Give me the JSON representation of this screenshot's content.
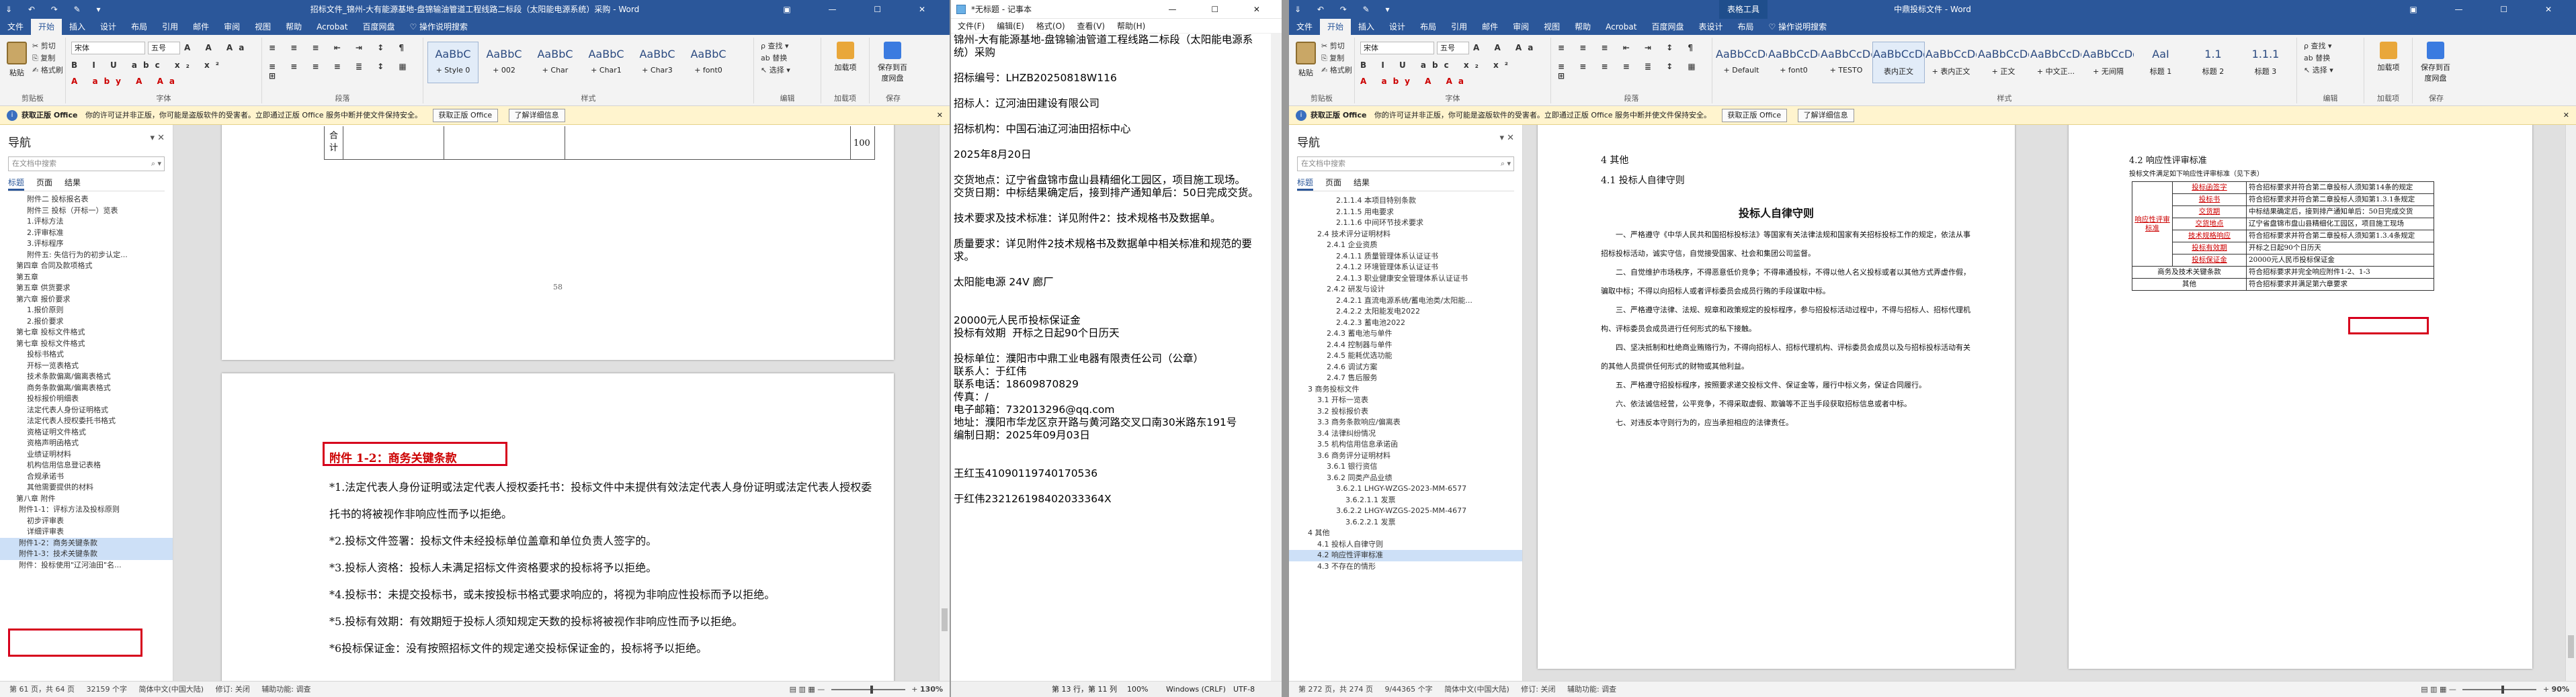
{
  "left_word": {
    "title": "招标文件_锦州-大有能源基地-盘锦输油管道工程线路二标段（太阳能电源系统）采购 - Word",
    "quick_access": "⇓ ↶ ↷ ✎ ▾",
    "window_controls": "▣ — ☐ ✕",
    "tabs": [
      "文件",
      "开始",
      "插入",
      "设计",
      "布局",
      "引用",
      "邮件",
      "审阅",
      "视图",
      "帮助",
      "Acrobat",
      "百度网盘",
      "♡ 操作说明搜索"
    ],
    "ribbon": {
      "paste": "粘贴",
      "cut": "✂ 剪切",
      "copy": "⎘ 复制",
      "format_painter": "✍ 格式刷",
      "font_name": "宋体",
      "font_size": "五号",
      "bold_row": "B I U abc x₂ x²",
      "color_row": "A aby A Aa",
      "para_row1": "≡ ≡ ≡ ⇤ ⇥ ↕ ¶",
      "para_row2": "≡ ≡ ≡ ≡ ≣ ↕ ▦ ⊞",
      "groups": [
        "剪贴板",
        "字体",
        "段落",
        "样式",
        "编辑",
        "加载项",
        "保存"
      ],
      "styles": [
        {
          "sample": "AaBbC",
          "name": "+ Style 0"
        },
        {
          "sample": "AaBbC",
          "name": "+ 002"
        },
        {
          "sample": "AaBbC",
          "name": "+ Char"
        },
        {
          "sample": "AaBbC",
          "name": "+ Char1"
        },
        {
          "sample": "AaBbC",
          "name": "+ Char3"
        },
        {
          "sample": "AaBbC",
          "name": "+ font0"
        }
      ],
      "find": "ρ 查找 ▾",
      "replace": "ab 替换",
      "select": "↖ 选择 ▾",
      "addins": "加载项",
      "save_baidu": "保存到百度网盘"
    },
    "warning": {
      "label": "获取正版 Office",
      "text": "你的许可证并非正版，你可能是盗版软件的受害者。立即通过正版 Office 服务中断并使文件保持安全。",
      "btn1": "获取正版 Office",
      "btn2": "了解详细信息"
    },
    "nav": {
      "title": "导航",
      "search_placeholder": "在文档中搜索",
      "tabs": [
        "标题",
        "页面",
        "结果"
      ],
      "items": [
        "附件二 投标报名表",
        "附件三 投标（开标一）览表",
        "1.评标方法",
        "2.评审标准",
        "3.评标程序",
        "附件五: 失信行为的初步认定...",
        "第四章 合同及款项格式",
        "第五章",
        "第五章 供货要求",
        "第六章 报价要求",
        "1.报价原则",
        "2.报价要求",
        "第七章 投标文件格式",
        "第七章 投标文件格式",
        "投标书格式",
        "开标一览表格式",
        "技术条款偏离/偏离表格式",
        "商务条款偏离/偏离表格式",
        "投标报价明细表",
        "法定代表人身份证明格式",
        "法定代表人授权委托书格式",
        "资格证明文件格式",
        "资格声明函格式",
        "业绩证明材料",
        "机构信用信息登记表格",
        "合规承诺书",
        "其他需要提供的材料",
        "第八章 附件",
        "附件1-1：评标方法及投标原则",
        "初步评审表",
        "详细评审表",
        "附件1-2：商务关键条款",
        "附件1-3：技术关键条款",
        "附件：投标使用\"辽河油田\"名..."
      ],
      "selected": [
        31,
        32
      ]
    },
    "page1": {
      "cell1": "合\n计",
      "cell_end": "100",
      "pageno": "58"
    },
    "page2": {
      "heading": "附件 1-2：商务关键条款",
      "paras": [
        "*1.法定代表人身份证明或法定代表人授权委托书：投标文件中未提供有效法定代表人身份证明或法定代表人授权委托书的将被视作非响应性而予以拒绝。",
        "*2.投标文件签署：投标文件未经投标单位盖章和单位负责人签字的。",
        "*3.投标人资格：投标人未满足招标文件资格要求的投标将予以拒绝。",
        "*4.投标书：未提交投标书，或未按投标书格式要求响应的，将视为非响应性投标而予以拒绝。",
        "*5.投标有效期：有效期短于投标人须知规定天数的投标将被视作非响应性而予以拒绝。",
        "*6投标保证金：没有按照招标文件的规定递交投标保证金的，投标将予以拒绝。"
      ]
    },
    "status": {
      "page": "第 61 页，共 64 页",
      "words": "32159 个字",
      "lang": "简体中文(中国大陆)",
      "track": "修订: 关闭",
      "access": "辅助功能: 调查",
      "zoom": "130%"
    }
  },
  "notepad": {
    "title": "*无标题 - 记事本",
    "window_controls": "— ☐ ✕",
    "menu": [
      "文件(F)",
      "编辑(E)",
      "格式(O)",
      "查看(V)",
      "帮助(H)"
    ],
    "text": "锦州-大有能源基地-盘锦输油管道工程线路二标段（太阳能电源系统）采购\n\n招标编号：LHZB20250818W116\n\n招标人：辽河油田建设有限公司\n\n招标机构：中国石油辽河油田招标中心\n\n2025年8月20日\n\n交货地点：辽宁省盘锦市盘山县精细化工园区，项目施工现场。\n交货日期：中标结果确定后，接到排产通知单后：50日完成交货。\n\n技术要求及技术标准：详见附件2：技术规格书及数据单。\n\n质量要求：详见附件2技术规格书及数据单中相关标准和规范的要求。\n\n太阳能电源 24V 廊厂\n\n\n20000元人民币投标保证金\n投标有效期  开标之日起90个日历天\n\n投标单位：濮阳市中鼎工业电器有限责任公司（公章）\n联系人：于红伟\n联系电话：18609870829\n传真：/\n电子邮箱：732013296@qq.com\n地址：濮阳市华龙区京开路与黄河路交叉口南30米路东191号\n编制日期：2025年09月03日\n\n\n王红玉41090119740170536\n\n于红伟232126198402033364X",
    "status": {
      "pos": "第 13 行，第 11 列",
      "zoom": "100%",
      "eol": "Windows (CRLF)",
      "enc": "UTF-8"
    }
  },
  "right_word": {
    "title": "中鼎投标文件 - Word",
    "context_tab": "表格工具",
    "quick_access": "⇓ ↶ ↷ ✎ ▾",
    "window_controls": "▣ — ☐ ✕",
    "tabs": [
      "文件",
      "开始",
      "插入",
      "设计",
      "布局",
      "引用",
      "邮件",
      "审阅",
      "视图",
      "帮助",
      "Acrobat",
      "百度网盘",
      "表设计",
      "布局",
      "♡ 操作说明搜索"
    ],
    "ribbon": {
      "paste": "粘贴",
      "cut": "✂ 剪切",
      "copy": "⎘ 复制",
      "format_painter": "✍ 格式刷",
      "font_name": "宋体",
      "font_size": "五号",
      "bold_row": "B I U abc x₂ x²",
      "color_row": "A aby A Aa",
      "para_row1": "≡ ≡ ≡ ⇤ ⇥ ↕ ¶",
      "para_row2": "≡ ≡ ≡ ≡ ≣ ↕ ▦ ⊞",
      "groups": [
        "剪贴板",
        "字体",
        "段落",
        "样式",
        "编辑",
        "加载项",
        "保存"
      ],
      "styles": [
        {
          "sample": "AaBbCcDc",
          "name": "+ Default"
        },
        {
          "sample": "AaBbCcDc",
          "name": "+ font0"
        },
        {
          "sample": "AaBbCcDc",
          "name": "+ TESTO"
        },
        {
          "sample": "AaBbCcDd",
          "name": "表内正文"
        },
        {
          "sample": "AaBbCcDd",
          "name": "+ 表内正文"
        },
        {
          "sample": "AaBbCcDd",
          "name": "+ 正文"
        },
        {
          "sample": "AaBbCcDd",
          "name": "+ 中文正..."
        },
        {
          "sample": "AaBbCcDd",
          "name": "+ 无间隔"
        },
        {
          "sample": "AaI",
          "name": "标题 1"
        },
        {
          "sample": "1.1",
          "name": "标题 2"
        },
        {
          "sample": "1.1.1",
          "name": "标题 3"
        }
      ],
      "find": "ρ 查找 ▾",
      "replace": "ab 替换",
      "select": "↖ 选择 ▾",
      "addins": "加载项",
      "save_baidu": "保存到百度网盘"
    },
    "warning": {
      "label": "获取正版 Office",
      "text": "你的许可证并非正版，你可能是盗版软件的受害者。立即通过正版 Office 服务中断并使文件保持安全。",
      "btn1": "获取正版 Office",
      "btn2": "了解详细信息"
    },
    "nav": {
      "title": "导航",
      "search_placeholder": "在文档中搜索",
      "tabs": [
        "标题",
        "页面",
        "结果"
      ],
      "items": [
        "2.1.1.4 本项目特别条款",
        "2.1.1.5 用电要求",
        "2.1.1.6 中间环节技术要求",
        "2.4 技术评分证明材料",
        "2.4.1 企业资质",
        "2.4.1.1 质量管理体系认证证书",
        "2.4.1.2 环境管理体系认证证书",
        "2.4.1.3 职业健康安全管理体系认证证书",
        "2.4.2 研发与设计",
        "2.4.2.1 直流电源系统/蓄电池类/太阳能...",
        "2.4.2.2 太阳能发电2022",
        "2.4.2.3 蓄电池2022",
        "2.4.3 蓄电池与单件",
        "2.4.4 控制器与单件",
        "2.4.5 能耗优选功能",
        "2.4.6 调试方案",
        "2.4.7 售后服务",
        "3 商务投标文件",
        "3.1 开标一览表",
        "3.2 投标报价表",
        "3.3 商务条款响应/偏离表",
        "3.4 法律纠纷情况",
        "3.5 机构信用信息承诺函",
        "3.6 商务评分证明材料",
        "3.6.1 银行资信",
        "3.6.2 同类产品业绩",
        "3.6.2.1 LHGY-WZGS-2023-MM-6577",
        "3.6.2.1.1 发票",
        "3.6.2.2 LHGY-WZGS-2025-MM-4677",
        "3.6.2.2.1 发票",
        "4 其他",
        "4.1 投标人自律守则",
        "4.2 响应性评审标准",
        "4.3 不存在的情形"
      ],
      "selected": [
        32
      ]
    },
    "page1": {
      "h_other": "4  其他",
      "h_41": "4.1   投标人自律守则",
      "title": "投标人自律守则",
      "paras": [
        "一、严格遵守《中华人民共和国招标投标法》等国家有关法律法规和国家有关招标投标工作的规定，依法从事招标投标活动，诚实守信，自觉接受国家、社会和集团公司监督。",
        "二、自觉维护市场秩序，不得恶意低价竞争；不得串通投标，不得以他人名义投标或者以其他方式弄虚作假，骗取中标；不得以向招标人或者评标委员会成员行贿的手段谋取中标。",
        "三、严格遵守法律、法规、规章和政策规定的投标程序，参与招投标活动过程中，不得与招标人、招标代理机构、评标委员会成员进行任何形式的私下接触。",
        "四、坚决抵制和杜绝商业贿赂行为，不得向招标人、招标代理机构、评标委员会成员以及与招标投标活动有关的其他人员提供任何形式的财物或其他利益。",
        "五、严格遵守招投标程序，按照要求递交投标文件、保证金等，履行中标义务，保证合同履行。",
        "六、依法诚信经营，公平竞争，不得采取虚假、欺骗等不正当手段获取招标信息或者中标。",
        "七、对违反本守则行为的，应当承担相应的法律责任。"
      ]
    },
    "page2": {
      "heading": "4.2   响应性评审标准",
      "subtitle": "投标文件满足如下响应性评审标准（见下表）",
      "group_label": "响应性评审标准",
      "rows": [
        [
          "投标函签字",
          "符合招标要求并符合第二章投标人须知第14条的规定"
        ],
        [
          "投标书",
          "符合招标要求并符合第二章投标人须知第1.3.1条规定"
        ],
        [
          "交货期",
          "中标结果确定后，接到排产通知单后：50日完成交货"
        ],
        [
          "交货地点",
          "辽宁省盘锦市盘山县精细化工园区，项目施工现场"
        ],
        [
          "技术规格响应",
          "符合招标要求并符合第二章投标人须知第1.3.4条规定"
        ],
        [
          "投标有效期",
          "开标之日起90个日历天"
        ],
        [
          "投标保证金",
          "20000元人民币投标保证金"
        ],
        [
          "商务及技术关键条款",
          "符合招标要求并完全响应附件1-2、1-3"
        ],
        [
          "其他",
          "符合招标要求并满足第六章要求"
        ]
      ]
    },
    "status": {
      "page": "第 272 页，共 274 页",
      "words": "9/44365 个字",
      "lang": "简体中文(中国大陆)",
      "track": "修订: 关闭",
      "access": "辅助功能: 调查",
      "zoom": "90%"
    }
  }
}
